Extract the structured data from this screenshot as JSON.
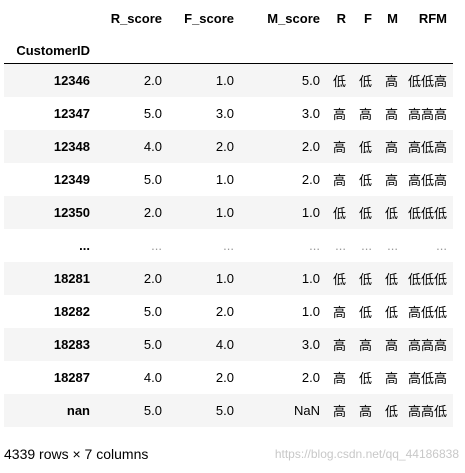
{
  "table": {
    "index_name": "CustomerID",
    "columns": [
      "R_score",
      "F_score",
      "M_score",
      "R",
      "F",
      "M",
      "RFM"
    ],
    "rows": [
      {
        "index": "12346",
        "cells": [
          "2.0",
          "1.0",
          "5.0",
          "低",
          "低",
          "高",
          "低低高"
        ]
      },
      {
        "index": "12347",
        "cells": [
          "5.0",
          "3.0",
          "3.0",
          "高",
          "高",
          "高",
          "高高高"
        ]
      },
      {
        "index": "12348",
        "cells": [
          "4.0",
          "2.0",
          "2.0",
          "高",
          "低",
          "高",
          "高低高"
        ]
      },
      {
        "index": "12349",
        "cells": [
          "5.0",
          "1.0",
          "2.0",
          "高",
          "低",
          "高",
          "高低高"
        ]
      },
      {
        "index": "12350",
        "cells": [
          "2.0",
          "1.0",
          "1.0",
          "低",
          "低",
          "低",
          "低低低"
        ]
      },
      {
        "index": "...",
        "cells": [
          "...",
          "...",
          "...",
          "...",
          "...",
          "...",
          "..."
        ]
      },
      {
        "index": "18281",
        "cells": [
          "2.0",
          "1.0",
          "1.0",
          "低",
          "低",
          "低",
          "低低低"
        ]
      },
      {
        "index": "18282",
        "cells": [
          "5.0",
          "2.0",
          "1.0",
          "高",
          "低",
          "低",
          "高低低"
        ]
      },
      {
        "index": "18283",
        "cells": [
          "5.0",
          "4.0",
          "3.0",
          "高",
          "高",
          "高",
          "高高高"
        ]
      },
      {
        "index": "18287",
        "cells": [
          "4.0",
          "2.0",
          "2.0",
          "高",
          "低",
          "高",
          "高低高"
        ]
      },
      {
        "index": "nan",
        "cells": [
          "5.0",
          "5.0",
          "NaN",
          "高",
          "高",
          "低",
          "高高低"
        ]
      }
    ]
  },
  "shape_note": "4339 rows × 7 columns",
  "watermark": "https://blog.csdn.net/qq_44186838"
}
